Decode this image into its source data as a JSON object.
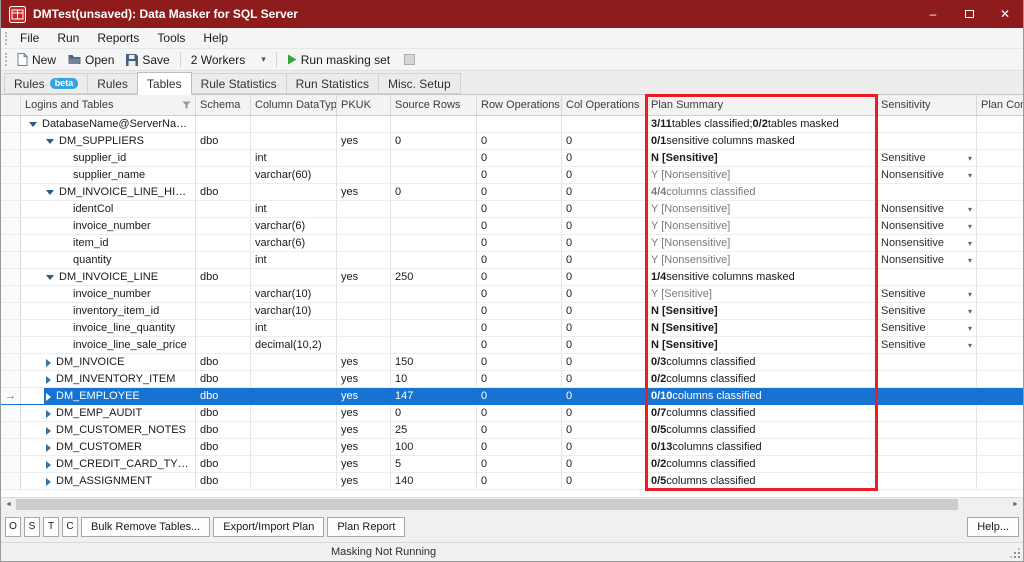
{
  "window": {
    "title": "DMTest(unsaved): Data Masker for SQL Server"
  },
  "icons": {
    "dropdown": "▾",
    "row_arrow": "→",
    "scroll_left": "◄",
    "scroll_right": "►",
    "minimize": "–",
    "close": "✕"
  },
  "colors": {
    "titlebar": "#8e1c1c",
    "selection": "#1673d2",
    "annotation": "#ec1c24",
    "badge": "#35a3dc",
    "run_green": "#3aa23a"
  },
  "menu": {
    "items": [
      "File",
      "Run",
      "Reports",
      "Tools",
      "Help"
    ]
  },
  "toolbar": {
    "new_label": "New",
    "open_label": "Open",
    "save_label": "Save",
    "workers_value": "2 Workers",
    "run_label": "Run masking set"
  },
  "tabs": [
    {
      "label": "Rules",
      "badge": "beta"
    },
    {
      "label": "Rules"
    },
    {
      "label": "Tables"
    },
    {
      "label": "Rule Statistics"
    },
    {
      "label": "Run Statistics"
    },
    {
      "label": "Misc. Setup"
    }
  ],
  "grid": {
    "columns": [
      "Logins and Tables",
      "Schema",
      "Column DataType",
      "PKUK",
      "Source Rows",
      "Row Operations",
      "Col Operations",
      "Plan Summary",
      "Sensitivity",
      "Plan Comm"
    ],
    "rows": [
      {
        "level": 0,
        "expand": "down",
        "name": "DatabaseName@ServerName\\In...",
        "schema": "",
        "datatype": "",
        "pkuk": "",
        "source_rows": "",
        "row_ops": "",
        "col_ops": "",
        "plan": [
          {
            "t": "3/11",
            "b": true
          },
          {
            "t": " tables classified; ",
            "b": false
          },
          {
            "t": "0/2",
            "b": true
          },
          {
            "t": " tables masked",
            "b": false
          }
        ],
        "plan_gray": false,
        "sensitivity": null,
        "selected": false
      },
      {
        "level": 1,
        "expand": "down",
        "name": "DM_SUPPLIERS",
        "schema": "dbo",
        "datatype": "",
        "pkuk": "yes",
        "source_rows": "0",
        "row_ops": "0",
        "col_ops": "0",
        "plan": [
          {
            "t": "0/1",
            "b": true
          },
          {
            "t": " sensitive columns masked",
            "b": false
          }
        ],
        "plan_gray": false,
        "sensitivity": null,
        "selected": false
      },
      {
        "level": 2,
        "expand": null,
        "name": "supplier_id",
        "schema": "",
        "datatype": "int",
        "pkuk": "",
        "source_rows": "",
        "row_ops": "0",
        "col_ops": "0",
        "plan": [
          {
            "t": "N [Sensitive]",
            "b": true
          }
        ],
        "plan_gray": false,
        "sensitivity": "Sensitive",
        "selected": false
      },
      {
        "level": 2,
        "expand": null,
        "name": "supplier_name",
        "schema": "",
        "datatype": "varchar(60)",
        "pkuk": "",
        "source_rows": "",
        "row_ops": "0",
        "col_ops": "0",
        "plan": [
          {
            "t": "Y [Nonsensitive]",
            "b": false
          }
        ],
        "plan_gray": true,
        "sensitivity": "Nonsensitive",
        "selected": false
      },
      {
        "level": 1,
        "expand": "down",
        "name": "DM_INVOICE_LINE_HISTORY",
        "schema": "dbo",
        "datatype": "",
        "pkuk": "yes",
        "source_rows": "0",
        "row_ops": "0",
        "col_ops": "0",
        "plan": [
          {
            "t": "4/4",
            "b": true
          },
          {
            "t": " columns classified",
            "b": false
          }
        ],
        "plan_gray": true,
        "sensitivity": null,
        "selected": false
      },
      {
        "level": 2,
        "expand": null,
        "name": "identCol",
        "schema": "",
        "datatype": "int",
        "pkuk": "",
        "source_rows": "",
        "row_ops": "0",
        "col_ops": "0",
        "plan": [
          {
            "t": "Y [Nonsensitive]",
            "b": false
          }
        ],
        "plan_gray": true,
        "sensitivity": "Nonsensitive",
        "selected": false
      },
      {
        "level": 2,
        "expand": null,
        "name": "invoice_number",
        "schema": "",
        "datatype": "varchar(6)",
        "pkuk": "",
        "source_rows": "",
        "row_ops": "0",
        "col_ops": "0",
        "plan": [
          {
            "t": "Y [Nonsensitive]",
            "b": false
          }
        ],
        "plan_gray": true,
        "sensitivity": "Nonsensitive",
        "selected": false
      },
      {
        "level": 2,
        "expand": null,
        "name": "item_id",
        "schema": "",
        "datatype": "varchar(6)",
        "pkuk": "",
        "source_rows": "",
        "row_ops": "0",
        "col_ops": "0",
        "plan": [
          {
            "t": "Y [Nonsensitive]",
            "b": false
          }
        ],
        "plan_gray": true,
        "sensitivity": "Nonsensitive",
        "selected": false
      },
      {
        "level": 2,
        "expand": null,
        "name": "quantity",
        "schema": "",
        "datatype": "int",
        "pkuk": "",
        "source_rows": "",
        "row_ops": "0",
        "col_ops": "0",
        "plan": [
          {
            "t": "Y [Nonsensitive]",
            "b": false
          }
        ],
        "plan_gray": true,
        "sensitivity": "Nonsensitive",
        "selected": false
      },
      {
        "level": 1,
        "expand": "down",
        "name": "DM_INVOICE_LINE",
        "schema": "dbo",
        "datatype": "",
        "pkuk": "yes",
        "source_rows": "250",
        "row_ops": "0",
        "col_ops": "0",
        "plan": [
          {
            "t": "1/4",
            "b": true
          },
          {
            "t": " sensitive columns masked",
            "b": false
          }
        ],
        "plan_gray": false,
        "sensitivity": null,
        "selected": false
      },
      {
        "level": 2,
        "expand": null,
        "name": "invoice_number",
        "schema": "",
        "datatype": "varchar(10)",
        "pkuk": "",
        "source_rows": "",
        "row_ops": "0",
        "col_ops": "0",
        "plan": [
          {
            "t": "Y [Sensitive]",
            "b": false
          }
        ],
        "plan_gray": true,
        "sensitivity": "Sensitive",
        "selected": false
      },
      {
        "level": 2,
        "expand": null,
        "name": "inventory_item_id",
        "schema": "",
        "datatype": "varchar(10)",
        "pkuk": "",
        "source_rows": "",
        "row_ops": "0",
        "col_ops": "0",
        "plan": [
          {
            "t": "N [Sensitive]",
            "b": true
          }
        ],
        "plan_gray": false,
        "sensitivity": "Sensitive",
        "selected": false
      },
      {
        "level": 2,
        "expand": null,
        "name": "invoice_line_quantity",
        "schema": "",
        "datatype": "int",
        "pkuk": "",
        "source_rows": "",
        "row_ops": "0",
        "col_ops": "0",
        "plan": [
          {
            "t": "N [Sensitive]",
            "b": true
          }
        ],
        "plan_gray": false,
        "sensitivity": "Sensitive",
        "selected": false
      },
      {
        "level": 2,
        "expand": null,
        "name": "invoice_line_sale_price",
        "schema": "",
        "datatype": "decimal(10,2)",
        "pkuk": "",
        "source_rows": "",
        "row_ops": "0",
        "col_ops": "0",
        "plan": [
          {
            "t": "N [Sensitive]",
            "b": true
          }
        ],
        "plan_gray": false,
        "sensitivity": "Sensitive",
        "selected": false
      },
      {
        "level": 1,
        "expand": "right",
        "name": "DM_INVOICE",
        "schema": "dbo",
        "datatype": "",
        "pkuk": "yes",
        "source_rows": "150",
        "row_ops": "0",
        "col_ops": "0",
        "plan": [
          {
            "t": "0/3",
            "b": true
          },
          {
            "t": " columns classified",
            "b": false
          }
        ],
        "plan_gray": false,
        "sensitivity": null,
        "selected": false
      },
      {
        "level": 1,
        "expand": "right",
        "name": "DM_INVENTORY_ITEM",
        "schema": "dbo",
        "datatype": "",
        "pkuk": "yes",
        "source_rows": "10",
        "row_ops": "0",
        "col_ops": "0",
        "plan": [
          {
            "t": "0/2",
            "b": true
          },
          {
            "t": " columns classified",
            "b": false
          }
        ],
        "plan_gray": false,
        "sensitivity": null,
        "selected": false
      },
      {
        "level": 1,
        "expand": "right",
        "name": "DM_EMPLOYEE",
        "schema": "dbo",
        "datatype": "",
        "pkuk": "yes",
        "source_rows": "147",
        "row_ops": "0",
        "col_ops": "0",
        "plan": [
          {
            "t": "0/10",
            "b": true
          },
          {
            "t": " columns classified",
            "b": false
          }
        ],
        "plan_gray": false,
        "sensitivity": null,
        "selected": true
      },
      {
        "level": 1,
        "expand": "right",
        "name": "DM_EMP_AUDIT",
        "schema": "dbo",
        "datatype": "",
        "pkuk": "yes",
        "source_rows": "0",
        "row_ops": "0",
        "col_ops": "0",
        "plan": [
          {
            "t": "0/7",
            "b": true
          },
          {
            "t": " columns classified",
            "b": false
          }
        ],
        "plan_gray": false,
        "sensitivity": null,
        "selected": false
      },
      {
        "level": 1,
        "expand": "right",
        "name": "DM_CUSTOMER_NOTES",
        "schema": "dbo",
        "datatype": "",
        "pkuk": "yes",
        "source_rows": "25",
        "row_ops": "0",
        "col_ops": "0",
        "plan": [
          {
            "t": "0/5",
            "b": true
          },
          {
            "t": " columns classified",
            "b": false
          }
        ],
        "plan_gray": false,
        "sensitivity": null,
        "selected": false
      },
      {
        "level": 1,
        "expand": "right",
        "name": "DM_CUSTOMER",
        "schema": "dbo",
        "datatype": "",
        "pkuk": "yes",
        "source_rows": "100",
        "row_ops": "0",
        "col_ops": "0",
        "plan": [
          {
            "t": "0/13",
            "b": true
          },
          {
            "t": " columns classified",
            "b": false
          }
        ],
        "plan_gray": false,
        "sensitivity": null,
        "selected": false
      },
      {
        "level": 1,
        "expand": "right",
        "name": "DM_CREDIT_CARD_TYPE",
        "schema": "dbo",
        "datatype": "",
        "pkuk": "yes",
        "source_rows": "5",
        "row_ops": "0",
        "col_ops": "0",
        "plan": [
          {
            "t": "0/2",
            "b": true
          },
          {
            "t": " columns classified",
            "b": false
          }
        ],
        "plan_gray": false,
        "sensitivity": null,
        "selected": false
      },
      {
        "level": 1,
        "expand": "right",
        "name": "DM_ASSIGNMENT",
        "schema": "dbo",
        "datatype": "",
        "pkuk": "yes",
        "source_rows": "140",
        "row_ops": "0",
        "col_ops": "0",
        "plan": [
          {
            "t": "0/5",
            "b": true
          },
          {
            "t": " columns classified",
            "b": false
          }
        ],
        "plan_gray": false,
        "sensitivity": null,
        "selected": false
      }
    ]
  },
  "footer": {
    "small_buttons": [
      "O",
      "S",
      "T",
      "C"
    ],
    "buttons": [
      "Bulk Remove Tables...",
      "Export/Import Plan",
      "Plan Report"
    ],
    "help": "Help..."
  },
  "status": {
    "text": "Masking Not Running"
  }
}
